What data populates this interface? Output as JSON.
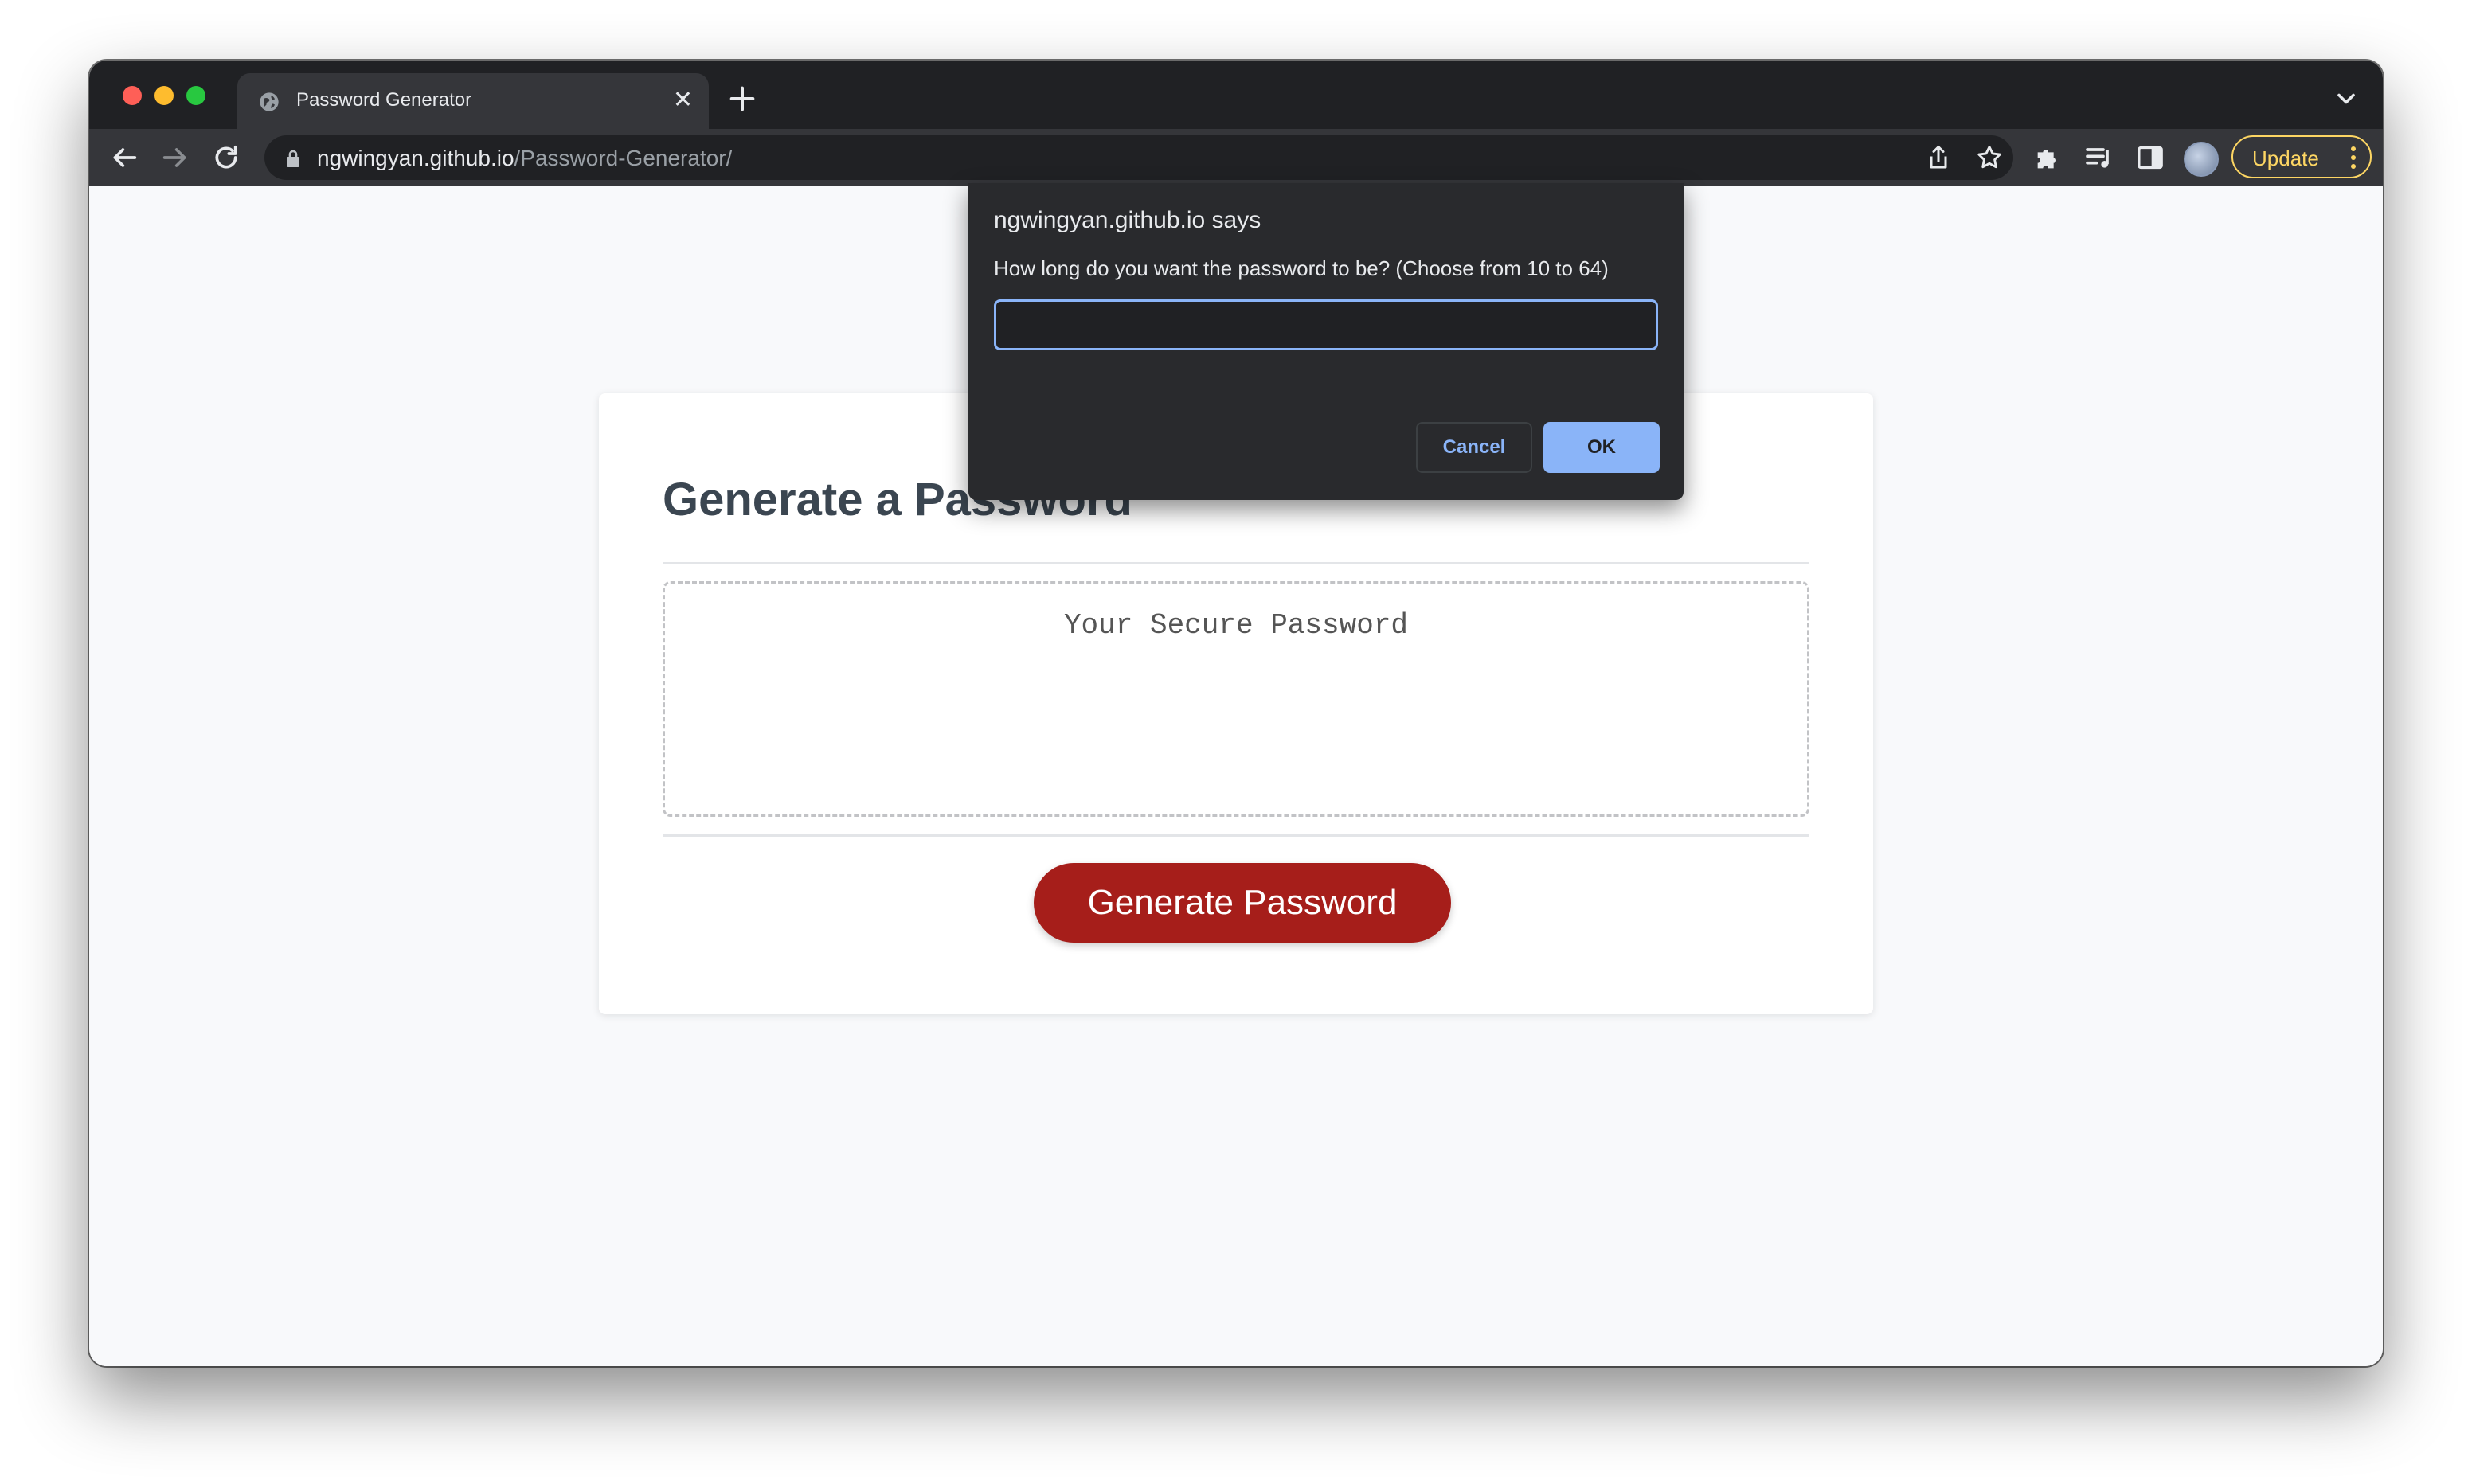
{
  "browser": {
    "tab": {
      "title": "Password Generator"
    },
    "address_bar": {
      "domain": "ngwingyan.github.io",
      "path": "/Password-Generator/"
    },
    "update_label": "Update",
    "colors": {
      "frame": "#202124",
      "toolbar": "#35363a",
      "update_accent": "#fdd663"
    }
  },
  "page": {
    "heading": "Generate a Password",
    "password_placeholder": "Your Secure Password",
    "generate_button": "Generate Password",
    "colors": {
      "button": "#a61e1a",
      "heading": "#3b4651"
    }
  },
  "dialog": {
    "title": "ngwingyan.github.io says",
    "message": "How long do you want the password to be? (Choose from 10 to 64)",
    "input_value": "",
    "cancel_label": "Cancel",
    "ok_label": "OK",
    "colors": {
      "accent": "#8ab4f8",
      "background": "#292a2d"
    }
  }
}
